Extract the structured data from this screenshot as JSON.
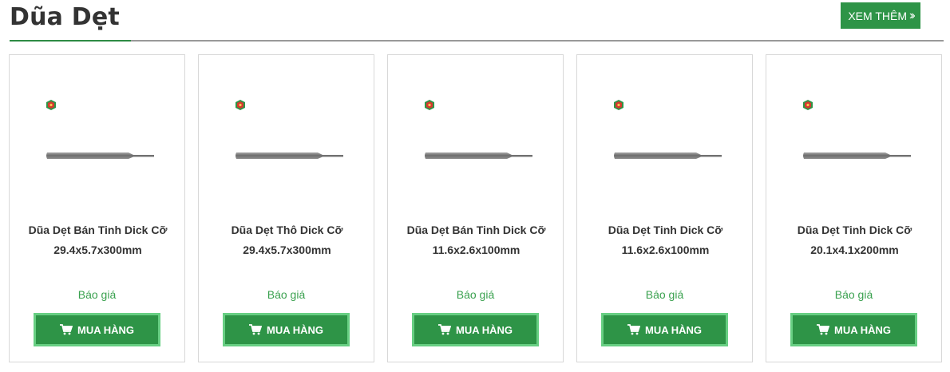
{
  "section": {
    "title": "Dũa Dẹt",
    "more_label": "XEM THÊM",
    "more_icon": "double-chevron-right-icon"
  },
  "products": [
    {
      "title_line1": "Dũa Dẹt Bán Tinh Dick Cỡ",
      "title_line2": "29.4x5.7x300mm",
      "price": "Báo giá",
      "buy_label": "MUA HÀNG"
    },
    {
      "title_line1": "Dũa Dẹt Thô Dick Cỡ",
      "title_line2": "29.4x5.7x300mm",
      "price": "Báo giá",
      "buy_label": "MUA HÀNG"
    },
    {
      "title_line1": "Dũa Dẹt Bán Tinh Dick Cỡ",
      "title_line2": "11.6x2.6x100mm",
      "price": "Báo giá",
      "buy_label": "MUA HÀNG"
    },
    {
      "title_line1": "Dũa Dẹt Tinh Dick Cỡ",
      "title_line2": "11.6x2.6x100mm",
      "price": "Báo giá",
      "buy_label": "MUA HÀNG"
    },
    {
      "title_line1": "Dũa Dẹt Tinh Dick Cỡ",
      "title_line2": "20.1x4.1x200mm",
      "price": "Báo giá",
      "buy_label": "MUA HÀNG"
    }
  ],
  "icons": {
    "cart": "cart-icon",
    "logo": "brand-logo-icon"
  },
  "colors": {
    "accent": "#2e9447",
    "button_border": "#68cf83",
    "price": "#3aa14f",
    "rule": "#999999"
  }
}
